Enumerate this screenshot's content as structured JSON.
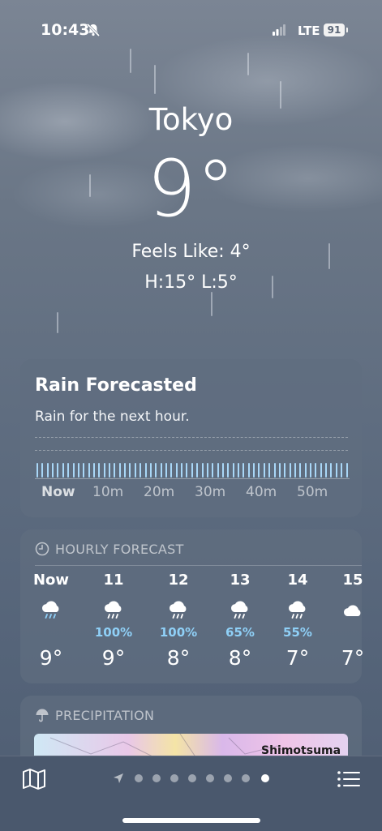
{
  "status_bar": {
    "time": "10:43",
    "network": "LTE",
    "battery": "91"
  },
  "location": {
    "city": "Tokyo",
    "temperature": "9°",
    "feels_like": "Feels Like: 4°",
    "high_low": "H:15°  L:5°"
  },
  "rain_card": {
    "title": "Rain Forecasted",
    "subtitle": "Rain for the next hour.",
    "time_labels": [
      "Now",
      "10m",
      "20m",
      "30m",
      "40m",
      "50m"
    ]
  },
  "hourly": {
    "header": "HOURLY FORECAST",
    "items": [
      {
        "hour": "Now",
        "icon": "rain-icon",
        "chance": "",
        "temp": "9°"
      },
      {
        "hour": "11",
        "icon": "rain-icon",
        "chance": "100%",
        "temp": "9°"
      },
      {
        "hour": "12",
        "icon": "rain-icon",
        "chance": "100%",
        "temp": "8°"
      },
      {
        "hour": "13",
        "icon": "rain-icon",
        "chance": "65%",
        "temp": "8°"
      },
      {
        "hour": "14",
        "icon": "rain-icon",
        "chance": "55%",
        "temp": "7°"
      },
      {
        "hour": "15",
        "icon": "cloud-icon",
        "chance": "",
        "temp": "7°"
      }
    ]
  },
  "precipitation": {
    "header": "PRECIPITATION",
    "map_label": "Shimotsuma"
  },
  "bottom_bar": {
    "map_icon": "map-icon",
    "list_icon": "list-icon",
    "location_icon": "location-arrow-icon"
  },
  "colors": {
    "rain_bar": "#a9d7f7",
    "chance_text": "#8fd0f7"
  }
}
